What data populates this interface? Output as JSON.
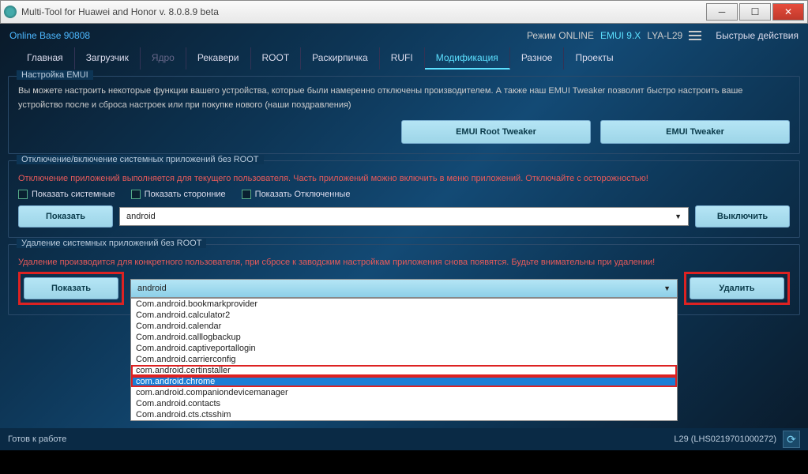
{
  "titlebar": {
    "title": "Multi-Tool for Huawei and Honor v. 8.0.8.9 beta"
  },
  "info": {
    "online_base": "Online Base 90808",
    "mode_label": "Режим ONLINE",
    "emui": "EMUI 9.X",
    "device": "LYA-L29",
    "fast_actions": "Быстрые действия"
  },
  "tabs": [
    "Главная",
    "Загрузчик",
    "Ядро",
    "Рекавери",
    "ROOT",
    "Раскирпичка",
    "RUFI",
    "Модификация",
    "Разное",
    "Проекты"
  ],
  "tabs_active_index": 7,
  "tabs_dim_index": 2,
  "emui_box": {
    "title": "Настройка EMUI",
    "text": "Вы можете настроить некоторые функции вашего устройства, которые были намеренно отключены производителем. А также наш EMUI Tweaker позволит быстро настроить ваше устройство после и сброса настроек или при покупке нового (наши поздравления)",
    "btn1": "EMUI Root Tweaker",
    "btn2": "EMUI Tweaker"
  },
  "disable_box": {
    "title": "Отключение/включение системных приложений без ROOT",
    "warning": "Отключение приложений выполняется для текущего пользователя. Часть приложений можно включить в меню приложений. Отключайте с осторожностью!",
    "cb1": "Показать системные",
    "cb2": "Показать сторонние",
    "cb3": "Показать Отключенные",
    "show_btn": "Показать",
    "selected": "android",
    "off_btn": "Выключить"
  },
  "delete_box": {
    "title": "Удаление системных приложений без ROOT",
    "warning": "Удаление производится для конкретного пользователя, при сбросе к заводским настройкам приложения снова появятся. Будьте внимательны при удалении!",
    "show_btn": "Показать",
    "selected": "android",
    "delete_btn": "Удалить",
    "options": [
      "Com.android.bookmarkprovider",
      "Com.android.calculator2",
      "Com.android.calendar",
      "Com.android.calllogbackup",
      "Com.android.captiveportallogin",
      "Com.android.carrierconfig",
      "com.android.certinstaller",
      "com.android.chrome",
      "com.android.companiondevicemanager",
      "Com.android.contacts",
      "Com.android.cts.ctsshim"
    ],
    "selected_option_index": 7
  },
  "statusbar": {
    "left": "Готов к работе",
    "right": "L29 (LHS0219701000272)"
  }
}
